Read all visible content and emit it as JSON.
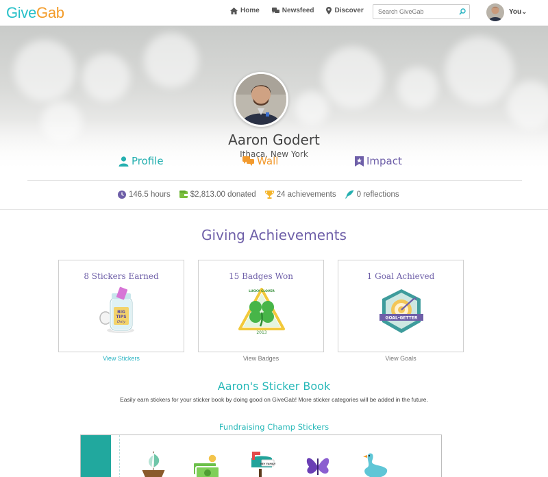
{
  "header": {
    "logo_part1": "Give",
    "logo_part2": "Gab",
    "nav": [
      {
        "label": "Home",
        "icon": "home-icon"
      },
      {
        "label": "Newsfeed",
        "icon": "newsfeed-icon"
      },
      {
        "label": "Discover",
        "icon": "map-pin-icon"
      }
    ],
    "search_placeholder": "Search GiveGab",
    "user_label": "You"
  },
  "profile": {
    "name": "Aaron Godert",
    "location": "Ithaca, New York",
    "tabs": [
      {
        "label": "Profile",
        "icon": "user-icon",
        "color": "#26b0b0"
      },
      {
        "label": "Wall",
        "icon": "chat-icon",
        "color": "#f29a2e"
      },
      {
        "label": "Impact",
        "icon": "ribbon-icon",
        "color": "#6e5fa8"
      }
    ],
    "stats": [
      {
        "text": "146.5 hours",
        "icon": "clock-icon",
        "color": "#6e5fa8"
      },
      {
        "text": "$2,813.00 donated",
        "icon": "wallet-icon",
        "color": "#7cbf3f"
      },
      {
        "text": "24 achievements",
        "icon": "trophy-icon",
        "color": "#f4b52b"
      },
      {
        "text": "0 reflections",
        "icon": "feather-icon",
        "color": "#26b0b0"
      }
    ]
  },
  "achievements": {
    "title": "Giving Achievements",
    "cards": [
      {
        "title": "8 Stickers Earned",
        "link": "View Stickers",
        "icon": "tip-jar-sticker-icon"
      },
      {
        "title": "15 Badges Won",
        "link": "View Badges",
        "icon": "lucky-clover-badge-icon"
      },
      {
        "title": "1 Goal Achieved",
        "link": "View Goals",
        "icon": "goal-getter-badge-icon"
      }
    ],
    "badge_text": {
      "jar_line1": "BIG",
      "jar_line2": "TIPS",
      "jar_line3": "Only",
      "clover_top": "LUCKY CLOVER",
      "clover_year": "2013",
      "goal_banner": "GOAL-GETTER"
    }
  },
  "sticker_book": {
    "title": "Aaron's Sticker Book",
    "description": "Easily earn stickers for your sticker book by doing good on GiveGab! More sticker categories will be added in the future.",
    "category_title": "Fundraising Champ Stickers",
    "mailbox_text": "HEY FAMILY",
    "stickers": [
      "ship-sticker-icon",
      "money-sticker-icon",
      "mailbox-sticker-icon",
      "butterfly-sticker-icon",
      "goose-sticker-icon"
    ]
  }
}
